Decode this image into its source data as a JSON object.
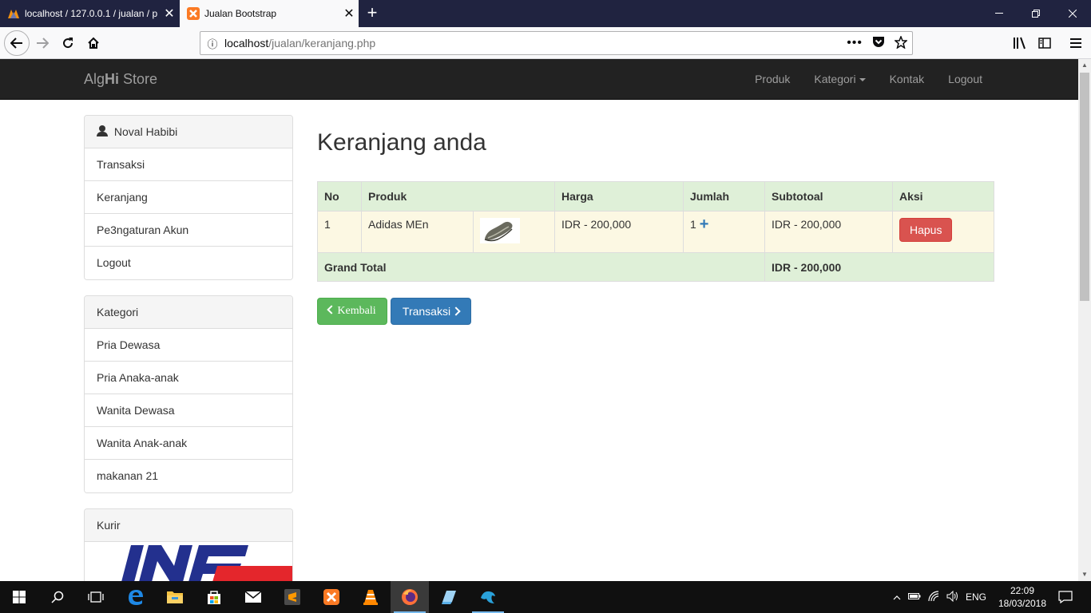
{
  "browser": {
    "tabs": [
      {
        "title": "localhost / 127.0.0.1 / jualan / p",
        "active": false
      },
      {
        "title": "Jualan Bootstrap",
        "active": true
      }
    ],
    "url_host": "localhost",
    "url_path": "/jualan/keranjang.php"
  },
  "site": {
    "brand_prefix": "Alg",
    "brand_bold": "Hi",
    "brand_suffix": " Store",
    "nav": [
      "Produk",
      "Kategori",
      "Kontak",
      "Logout"
    ]
  },
  "sidebar": {
    "user_name": "Noval Habibi",
    "user_menu": [
      "Transaksi",
      "Keranjang",
      "Pe3ngaturan Akun",
      "Logout"
    ],
    "kategori_title": "Kategori",
    "kategori": [
      "Pria Dewasa",
      "Pria Anaka-anak",
      "Wanita Dewasa",
      "Wanita Anak-anak",
      "makanan 21"
    ],
    "kurir_title": "Kurir",
    "kurir_logo_text": "JNE"
  },
  "main": {
    "title": "Keranjang anda",
    "table": {
      "headers": [
        "No",
        "Produk",
        "Harga",
        "Jumlah",
        "Subtotoal",
        "Aksi"
      ],
      "rows": [
        {
          "no": "1",
          "produk": "Adidas MEn",
          "harga": "IDR - 200,000",
          "jumlah": "1",
          "subtotal": "IDR - 200,000",
          "aksi": "Hapus"
        }
      ],
      "grand_total_label": "Grand Total",
      "grand_total_value": "IDR - 200,000"
    },
    "buttons": {
      "back": "Kembali",
      "checkout": "Transaksi"
    }
  },
  "taskbar": {
    "language": "ENG",
    "time": "22:09",
    "date": "18/03/2018"
  },
  "colors": {
    "navbar": "#222222",
    "success_row": "#dff0d8",
    "warning_row": "#fcf8e3",
    "danger": "#d9534f",
    "success": "#5cb85c",
    "primary": "#337ab7",
    "jne_blue": "#23308e",
    "jne_red": "#e4262c"
  }
}
